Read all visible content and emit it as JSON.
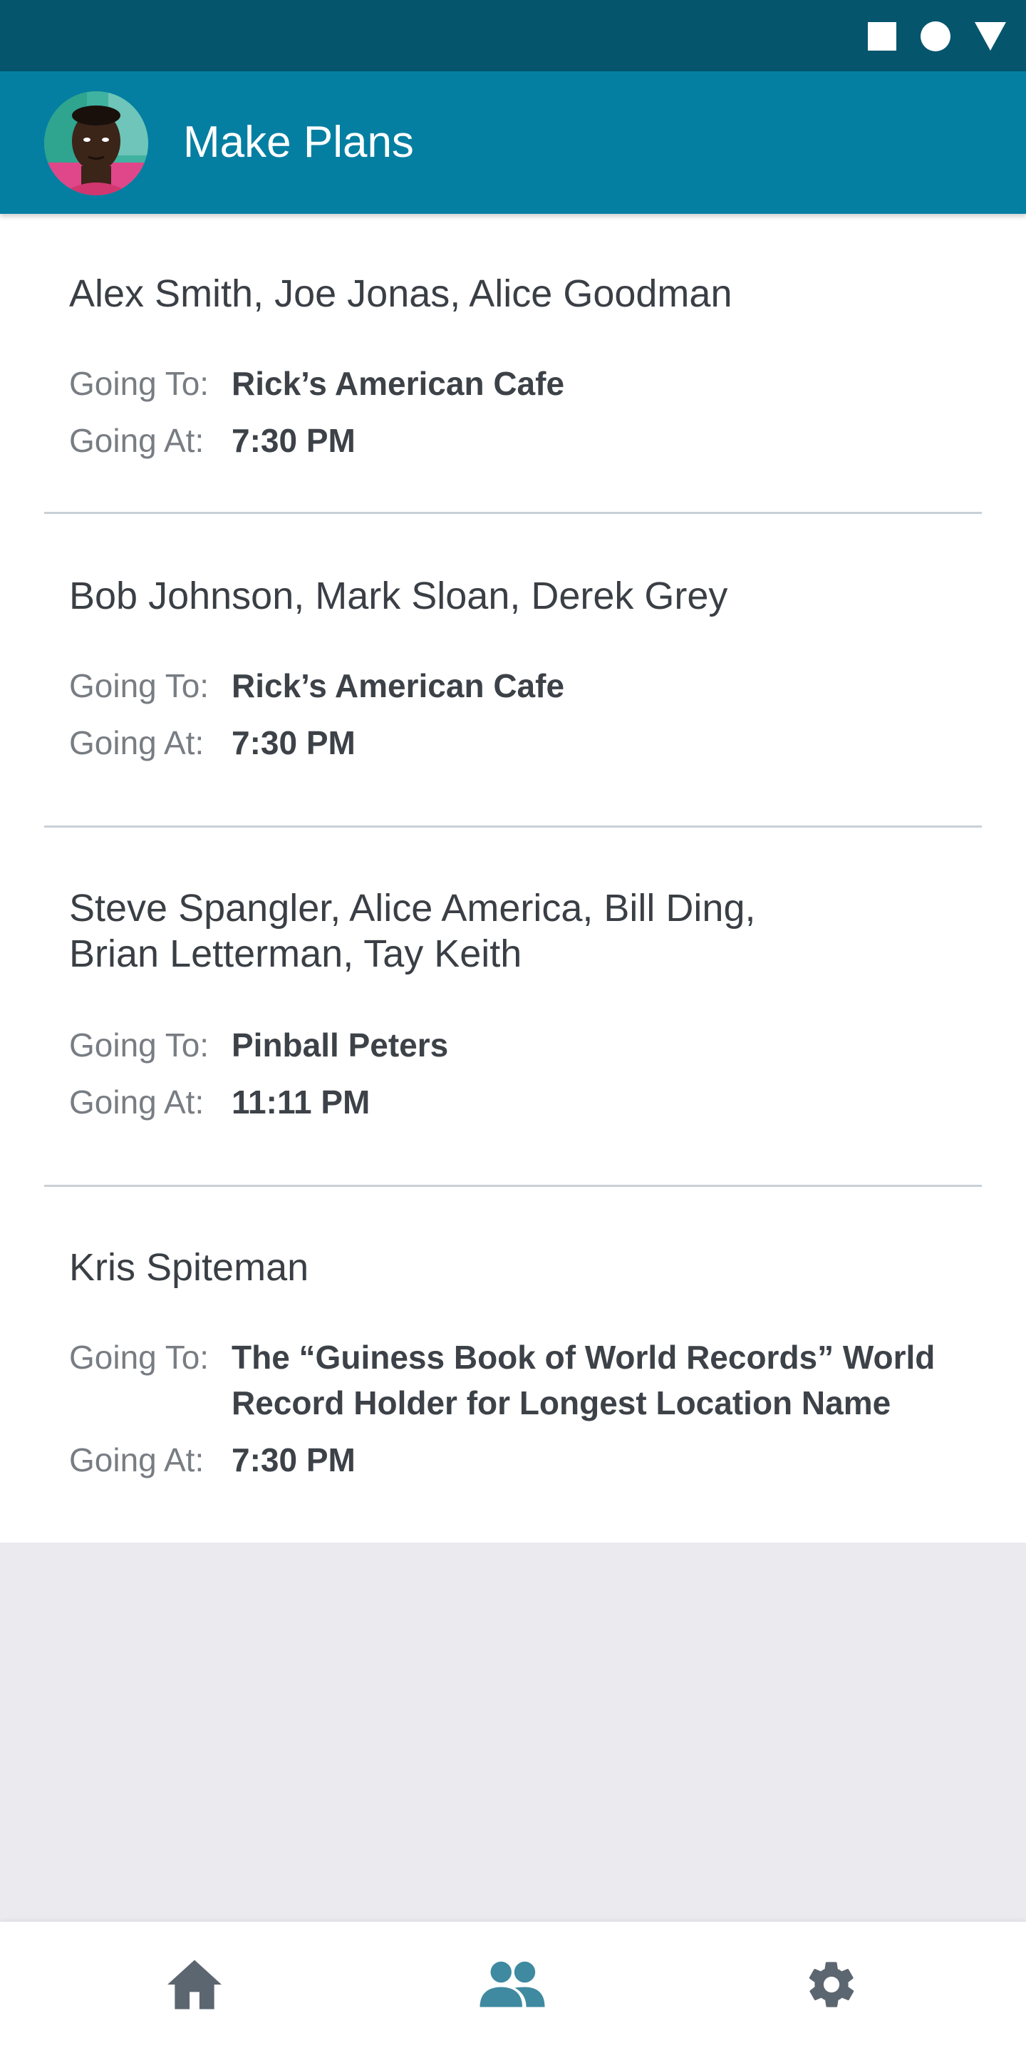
{
  "status_bar": {
    "icons": [
      "square-icon",
      "circle-icon",
      "triangle-icon"
    ]
  },
  "app_bar": {
    "title": "Make Plans",
    "color": "#047fa2",
    "status_color": "#05556c"
  },
  "labels": {
    "going_to": "Going To:",
    "going_at": "Going At:"
  },
  "plans": [
    {
      "names": [
        "Alex Smith, Joe Jonas, Alice Goodman"
      ],
      "going_to": [
        "Rick’s American Cafe"
      ],
      "going_at": "7:30 PM"
    },
    {
      "names": [
        "Bob Johnson, Mark Sloan, Derek Grey"
      ],
      "going_to": [
        "Rick’s American Cafe"
      ],
      "going_at": "7:30 PM"
    },
    {
      "names": [
        "Steve Spangler, Alice America, Bill Ding,",
        "Brian Letterman, Tay Keith"
      ],
      "going_to": [
        "Pinball Peters"
      ],
      "going_at": "11:11 PM"
    },
    {
      "names": [
        "Kris Spiteman"
      ],
      "going_to": [
        "The “Guiness Book of World Records” World",
        "Record Holder for Longest Location Name"
      ],
      "going_at": "7:30 PM"
    }
  ],
  "bottom_nav": {
    "items": [
      {
        "icon": "home-icon",
        "color": "#5c6670"
      },
      {
        "icon": "people-icon",
        "color": "#3f8aa0",
        "active": true
      },
      {
        "icon": "gear-icon",
        "color": "#5c6670"
      }
    ]
  }
}
